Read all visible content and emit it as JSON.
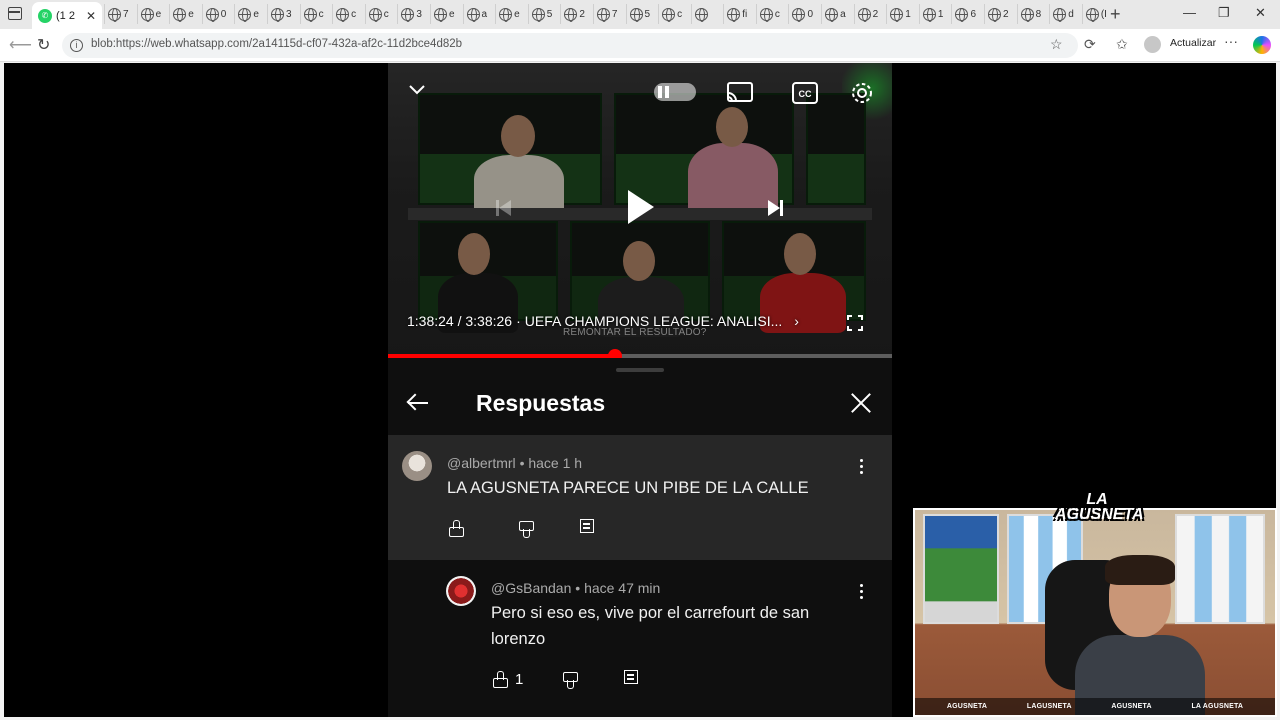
{
  "browser": {
    "active_tab_label": "(1 2",
    "tab_letters": [
      "7",
      "e",
      "e",
      "0",
      "e",
      "3",
      "c",
      "c",
      "c",
      "3",
      "e",
      "a",
      "e",
      "5",
      "2",
      "7",
      "5",
      "c",
      "",
      "fi",
      "c",
      "0",
      "a",
      "2",
      "1",
      "1",
      "6",
      "2",
      "8",
      "d",
      "(I"
    ],
    "url": "blob:https://web.whatsapp.com/2a14115d-cf07-432a-af2c-11d2bce4d82b",
    "update_label": "Actualizar",
    "icons": [
      "back-icon",
      "reload-icon",
      "info-icon",
      "star-icon",
      "refresh-icon",
      "favorites-icon",
      "profile-icon",
      "more-icon",
      "copilot-icon"
    ]
  },
  "video": {
    "time": "1:38:24 / 3:38:26",
    "separator": "·",
    "title": "UEFA CHAMPIONS LEAGUE: ANALISI...",
    "subtitle": "REMONTAR EL RESULTADO?",
    "progress": 0.4508,
    "accent": "#ff0000"
  },
  "replies": {
    "title": "Respuestas",
    "comments": [
      {
        "author": "@albertmrl",
        "time": "hace 1 h",
        "text": "LA AGUSNETA PARECE UN PIBE DE LA CALLE",
        "likes": ""
      },
      {
        "author": "@GsBandan",
        "time": "hace 47 min",
        "text": "Pero si eso es, vive por el carrefourt de san lorenzo",
        "likes": "1"
      }
    ]
  },
  "overlay": {
    "logo": "LA AGUSNETA",
    "socials": [
      "AGUSNETA",
      "LAGUSNETA",
      "AGUSNETA",
      "LA AGUSNETA"
    ]
  }
}
